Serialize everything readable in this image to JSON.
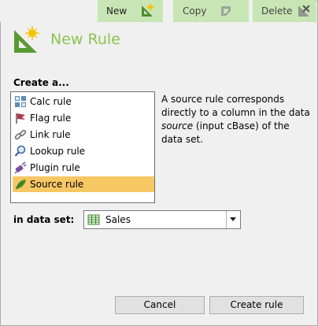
{
  "toolbar": {
    "new_label": "New",
    "copy_label": "Copy",
    "delete_label": "Delete"
  },
  "header": {
    "title": "New Rule"
  },
  "create": {
    "label": "Create a...",
    "items": [
      {
        "label": "Calc rule",
        "icon": "calc-rule-icon"
      },
      {
        "label": "Flag rule",
        "icon": "flag-icon"
      },
      {
        "label": "Link rule",
        "icon": "link-icon"
      },
      {
        "label": "Lookup rule",
        "icon": "lookup-icon"
      },
      {
        "label": "Plugin rule",
        "icon": "plugin-icon"
      },
      {
        "label": "Source rule",
        "icon": "source-icon",
        "selected": true
      }
    ]
  },
  "description": {
    "part1": "A source rule corresponds directly to a column in the data ",
    "italic": "source",
    "part2": " (input cBase) of the data set."
  },
  "dataset": {
    "label": "in data set:",
    "value": "Sales"
  },
  "buttons": {
    "cancel": "Cancel",
    "create": "Create rule"
  },
  "colors": {
    "accent_green": "#8cc350",
    "toolbar_green": "#c8e6b5",
    "selection": "#f7c764"
  }
}
